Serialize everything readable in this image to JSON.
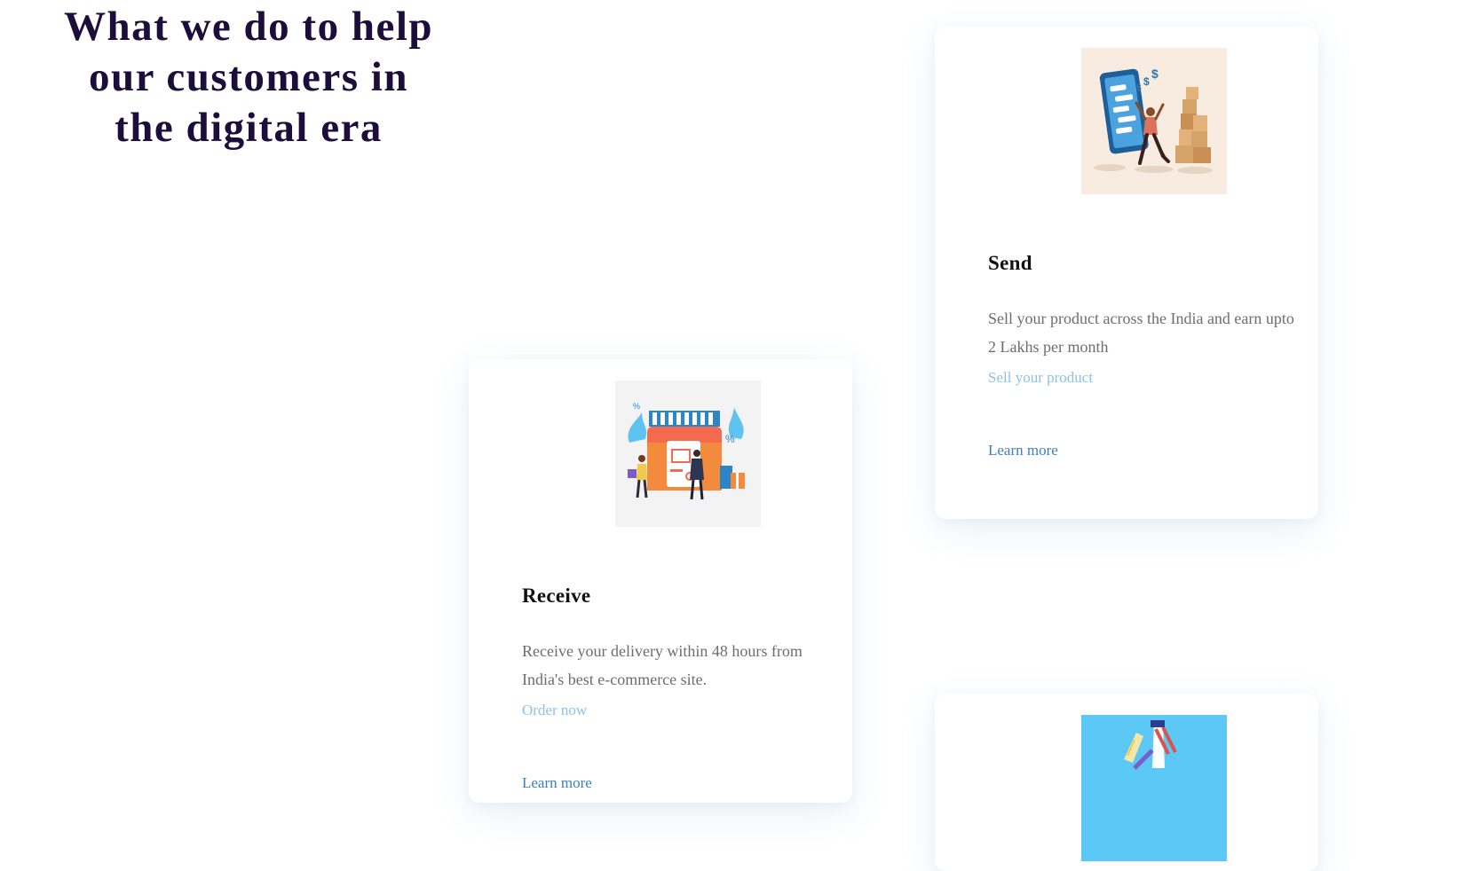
{
  "heading": {
    "text": "What we do to help our customers in the digital era"
  },
  "cards": [
    {
      "title": "Send",
      "description": "Sell your product across the India and earn upto 2 Lakhs per month",
      "cta": "Sell your product",
      "learn_more": "Learn more",
      "image_icon": "delivery-boxes-illustration"
    },
    {
      "title": "Receive",
      "description": "Receive your delivery within 48 hours from India's best e-commerce site.",
      "cta": "Order now",
      "learn_more": "Learn more",
      "image_icon": "online-store-illustration"
    },
    {
      "image_icon": "storefront-illustration"
    }
  ],
  "colors": {
    "heading": "#1c0d3a",
    "cta_link": "#8ec1e6",
    "learn_more_link": "#3a7ebd",
    "body_text": "#6d6d6d",
    "card_title": "#111111"
  }
}
